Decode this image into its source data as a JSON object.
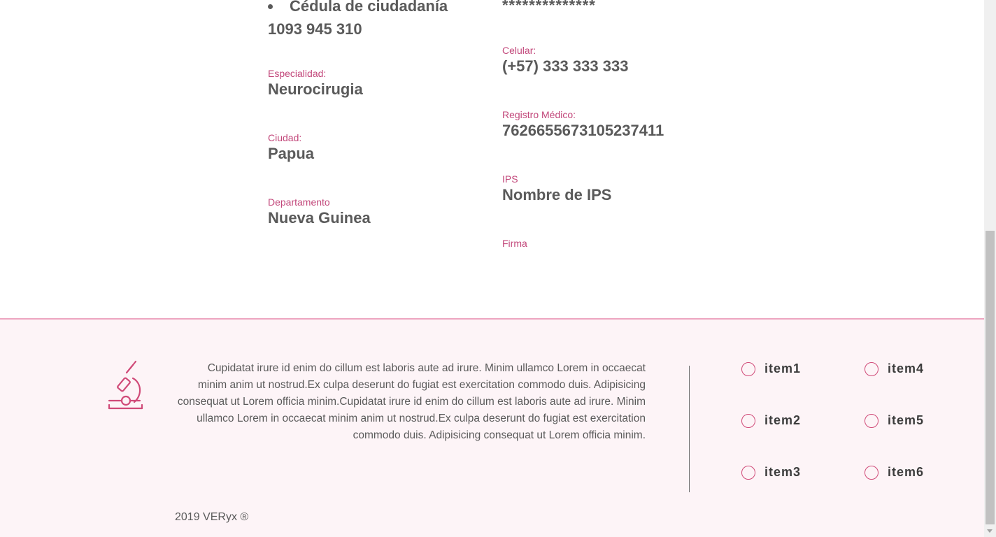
{
  "profile": {
    "left": {
      "document_type": "Cédula de ciudadanía",
      "document_number": "1093 945 310",
      "specialty_label": "Especialidad:",
      "specialty_value": "Neurocirugia",
      "city_label": "Ciudad:",
      "city_value": "Papua",
      "department_label": "Departamento",
      "department_value": "Nueva Guinea"
    },
    "right": {
      "password_mask": "**************",
      "phone_label": "Celular:",
      "phone_value": "(+57) 333 333 333",
      "registry_label": "Registro Médico:",
      "registry_value": "762665567310523741​1",
      "ips_label": "IPS",
      "ips_value": "Nombre de IPS",
      "signature_label": "Firma"
    }
  },
  "footer": {
    "logo_icon": "microscope-icon",
    "description": "Cupidatat irure id enim do cillum est laboris aute ad irure. Minim ullamco Lorem in occaecat minim anim ut nostrud.Ex culpa deserunt do fugiat est exercitation commodo duis. Adipisicing consequat ut Lorem officia minim.Cupidatat irure id enim do cillum est laboris aute ad irure. Minim ullamco Lorem in occaecat minim anim ut nostrud.Ex culpa deserunt do fugiat est exercitation commodo duis. Adipisicing consequat ut Lorem officia minim.",
    "menu": [
      {
        "label": "item1"
      },
      {
        "label": "item2"
      },
      {
        "label": "item3"
      },
      {
        "label": "item4"
      },
      {
        "label": "item5"
      },
      {
        "label": "item6"
      }
    ],
    "copyright": "2019 VERyx ®"
  },
  "colors": {
    "accent": "#c2477a",
    "footer_bg": "#fdf4f7",
    "footer_border": "#eda5c0"
  }
}
